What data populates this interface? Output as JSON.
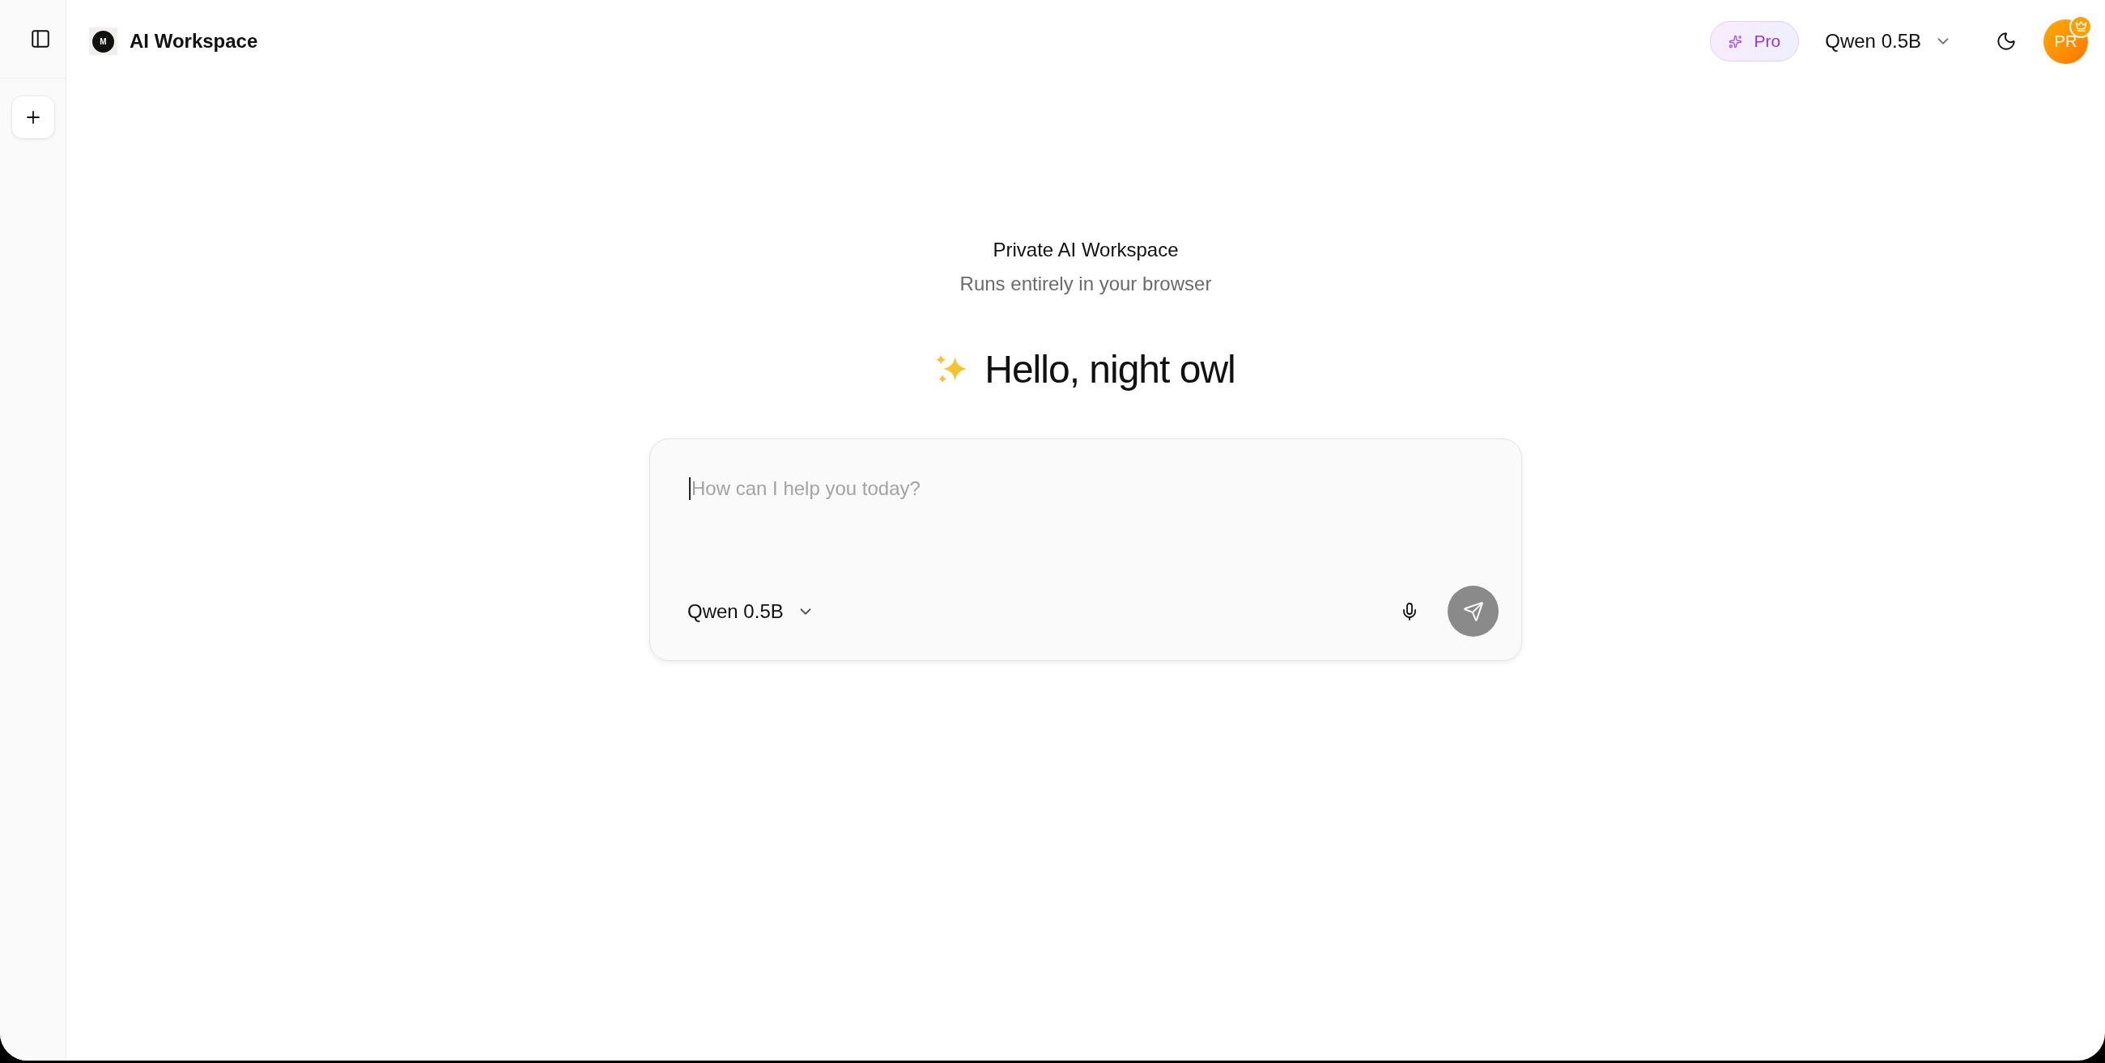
{
  "header": {
    "logo_letter": "M",
    "app_name": "AI Workspace",
    "pro_badge": "Pro",
    "model_selector": "Qwen 0.5B",
    "avatar_initials": "PR"
  },
  "intro": {
    "title": "Private AI Workspace",
    "subtitle": "Runs entirely in your browser",
    "greeting": "Hello, night owl"
  },
  "composer": {
    "placeholder": "How can I help you today?",
    "model_selector": "Qwen 0.5B"
  }
}
